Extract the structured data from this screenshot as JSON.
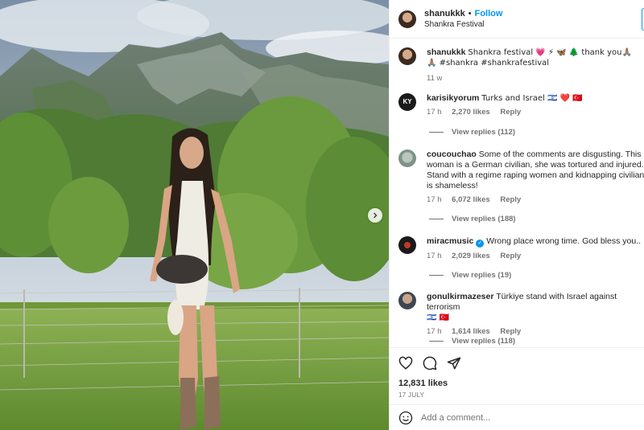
{
  "post": {
    "username": "shanukkk",
    "follow_label": "Follow",
    "location": "Shankra Festival",
    "caption_user": "shanukkk",
    "caption_text": "Shankra festival 💗 ⚡ 🦋 🌲 thank you🙏🏽",
    "caption_tags": "🙏🏽 #shankra #shankrafestival",
    "caption_age": "11 w",
    "likes": "12,831 likes",
    "date": "17 JULY",
    "add_comment_placeholder": "Add a comment..."
  },
  "comments": [
    {
      "user": "karisikyorum",
      "text": "Turks and Israel 🇮🇱 ❤️ 🇹🇷",
      "age": "17 h",
      "likes": "2,270 likes",
      "reply": "Reply",
      "view_replies": "View replies (112)"
    },
    {
      "user": "coucouchao",
      "text": "Some of the comments are disgusting. This woman is a German civilian, she was tortured and injured. Stand with a regime raping women and kidnapping civilian is shameless!",
      "age": "17 h",
      "likes": "6,072 likes",
      "reply": "Reply",
      "view_replies": "View replies (188)"
    },
    {
      "user": "miracmusic",
      "text": "Wrong place wrong time. God bless you..",
      "age": "17 h",
      "likes": "2,029 likes",
      "reply": "Reply",
      "view_replies": "View replies (19)"
    },
    {
      "user": "gonulkirmazeser",
      "text": "Türkiye stand with Israel against terrorism",
      "text2": "🇮🇱 🇹🇷",
      "age": "17 h",
      "likes": "1,614 likes",
      "reply": "Reply",
      "view_replies": "View replies (118)"
    }
  ],
  "icons": {
    "like": "heart-icon",
    "comment": "comment-icon",
    "share": "share-icon",
    "emoji": "emoji-icon",
    "next": "chevron-right-icon",
    "verified": "verified-badge-icon"
  },
  "colors": {
    "link_blue": "#0095f6",
    "muted_text": "#737373",
    "divider": "#efefef"
  }
}
